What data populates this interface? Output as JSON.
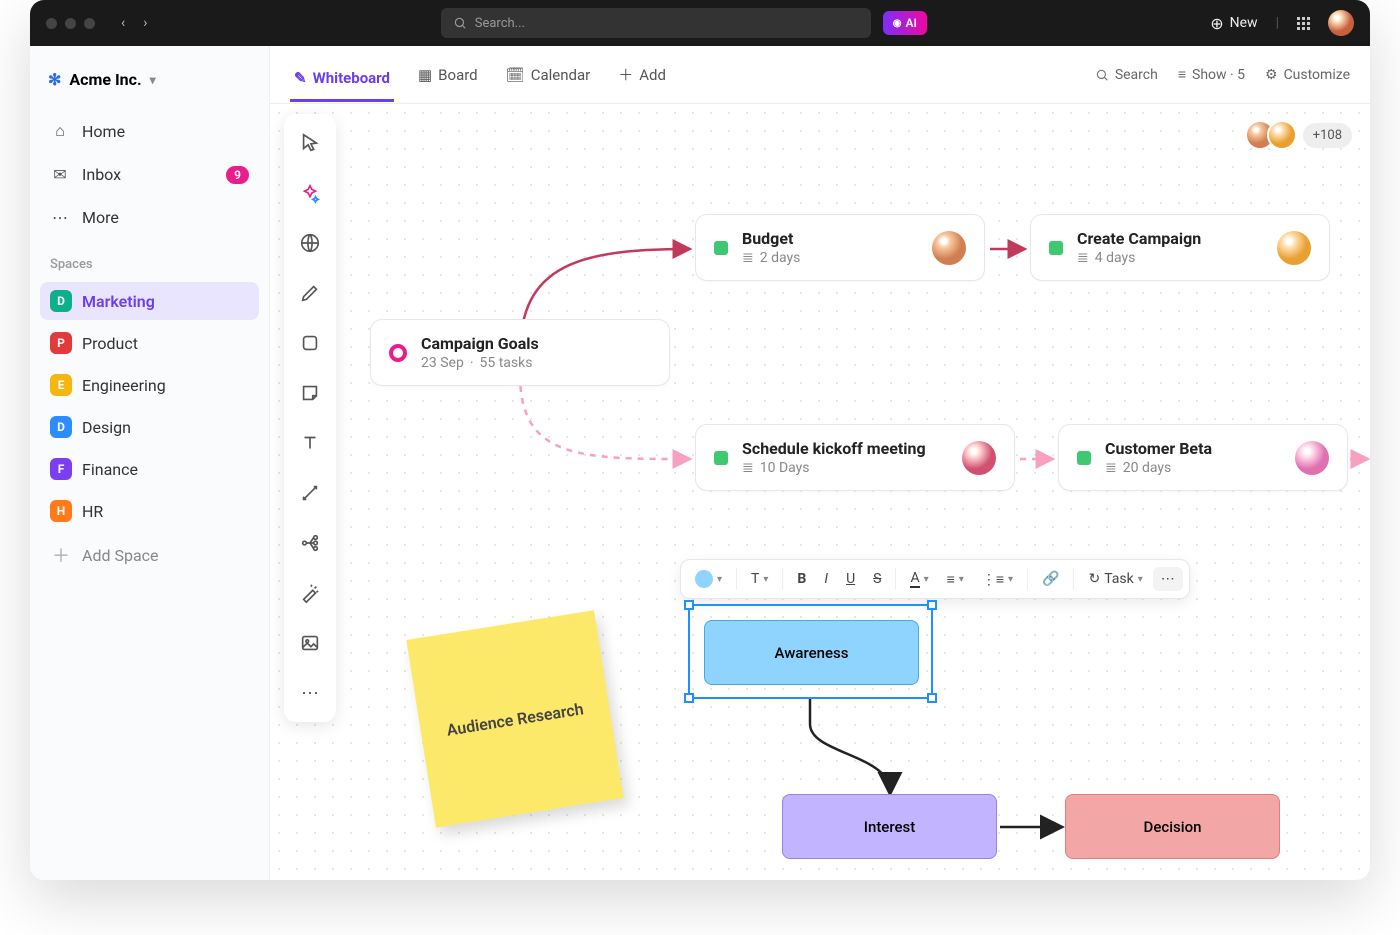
{
  "topbar": {
    "search_placeholder": "Search...",
    "ai_label": "AI",
    "new_label": "New"
  },
  "workspace": {
    "name": "Acme Inc."
  },
  "nav": {
    "home": "Home",
    "inbox": "Inbox",
    "inbox_count": "9",
    "more": "More"
  },
  "spaces_label": "Spaces",
  "spaces": [
    {
      "letter": "D",
      "label": "Marketing",
      "color": "#0cb08a"
    },
    {
      "letter": "P",
      "label": "Product",
      "color": "#e03a3a"
    },
    {
      "letter": "E",
      "label": "Engineering",
      "color": "#f5b70f"
    },
    {
      "letter": "D",
      "label": "Design",
      "color": "#2d8cff"
    },
    {
      "letter": "F",
      "label": "Finance",
      "color": "#7b3ef0"
    },
    {
      "letter": "H",
      "label": "HR",
      "color": "#ff7a18"
    }
  ],
  "add_space": "Add Space",
  "views": {
    "whiteboard": "Whiteboard",
    "board": "Board",
    "calendar": "Calendar",
    "add": "Add"
  },
  "view_actions": {
    "search": "Search",
    "show": "Show · 5",
    "customize": "Customize"
  },
  "presence_extra": "+108",
  "cards": {
    "goals": {
      "title": "Campaign Goals",
      "date": "23 Sep",
      "tasks": "55 tasks"
    },
    "budget": {
      "title": "Budget",
      "meta": "2 days"
    },
    "create": {
      "title": "Create Campaign",
      "meta": "4 days"
    },
    "kickoff": {
      "title": "Schedule kickoff meeting",
      "meta": "10 Days"
    },
    "beta": {
      "title": "Customer Beta",
      "meta": "20 days"
    }
  },
  "sticky": {
    "text": "Audience Research"
  },
  "flow": {
    "awareness": "Awareness",
    "interest": "Interest",
    "decision": "Decision"
  },
  "toolbar": {
    "task": "Task"
  }
}
